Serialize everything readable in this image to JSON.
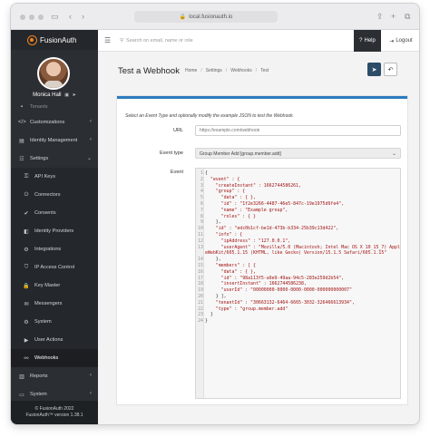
{
  "browser": {
    "url": "local.fusionauth.io"
  },
  "brand": {
    "name": "FusionAuth"
  },
  "user": {
    "name": "Monica Hall"
  },
  "sidebar": {
    "cut_item": "Tenants",
    "items": [
      {
        "label": "Customizations",
        "icon": "code-icon",
        "chevron": "‹",
        "type": "top"
      },
      {
        "label": "Identity Management",
        "icon": "id-card-icon",
        "chevron": "‹",
        "type": "top"
      },
      {
        "label": "Settings",
        "icon": "sliders-icon",
        "chevron": "⌄",
        "type": "top"
      },
      {
        "label": "API Keys",
        "icon": "key-icon",
        "type": "sub"
      },
      {
        "label": "Connectors",
        "icon": "plug-icon",
        "type": "sub"
      },
      {
        "label": "Consents",
        "icon": "check-icon",
        "type": "sub"
      },
      {
        "label": "Identity Providers",
        "icon": "id-icon",
        "type": "sub"
      },
      {
        "label": "Integrations",
        "icon": "gear-icon",
        "type": "sub"
      },
      {
        "label": "IP Access Control",
        "icon": "shield-icon",
        "type": "sub"
      },
      {
        "label": "Key Master",
        "icon": "lock-icon",
        "type": "sub"
      },
      {
        "label": "Messengers",
        "icon": "chat-icon",
        "type": "sub"
      },
      {
        "label": "System",
        "icon": "cog-icon",
        "type": "sub"
      },
      {
        "label": "User Actions",
        "icon": "play-icon",
        "type": "sub"
      },
      {
        "label": "Webhooks",
        "icon": "link-icon",
        "type": "sub",
        "active": true
      },
      {
        "label": "Reports",
        "icon": "chart-icon",
        "chevron": "‹",
        "type": "top"
      },
      {
        "label": "System",
        "icon": "desktop-icon",
        "chevron": "‹",
        "type": "top"
      }
    ],
    "footer_line1": "© FusionAuth 2022",
    "footer_line2": "FusionAuth™ version 1.38.1"
  },
  "topbar": {
    "search_placeholder": "Search on email, name or role",
    "help_label": "Help",
    "logout_label": "Logout"
  },
  "page": {
    "title": "Test a Webhook",
    "breadcrumbs": [
      "Home",
      "Settings",
      "Webhooks",
      "Test"
    ]
  },
  "form": {
    "intro": "Select an Event Type and optionally modify the example JSON to test the Webhook.",
    "url_label": "URL",
    "url_placeholder": "https://example.com/webhook",
    "event_type_label": "Event type",
    "event_type_value": "Group Member Add [group.member.add]",
    "event_label": "Event",
    "event_json": [
      "{",
      "  \"event\" : {",
      "    \"createInstant\" : 1662744586261,",
      "    \"group\" : {",
      "      \"data\" : { },",
      "      \"id\" : \"1f2e3266-4487-46e5-847c-19e1975d6fe4\",",
      "      \"name\" : \"Example group\",",
      "      \"roles\" : { }",
      "    },",
      "    \"id\" : \"edc0b1cf-be1d-473b-b334-25b39c13d422\",",
      "    \"info\" : {",
      "      \"ipAddress\" : \"127.0.0.1\",",
      "      \"userAgent\" : \"Mozilla/5.0 (Macintosh; Intel Mac OS X 10_15_7) AppleWebKit/605.1.15 (KHTML, like Gecko) Version/15.1.5 Safari/605.1.15\"",
      "    },",
      "    \"members\" : [ {",
      "      \"data\" : { },",
      "      \"id\" : \"98a113f5-a9e9-49aa-94c5-283e259d2b54\",",
      "      \"insertInstant\" : 1662744586238,",
      "      \"userId\" : \"00000000-0000-0000-0000-000000000007\"",
      "    } ],",
      "    \"tenantId\" : \"30663132-6464-6665-3032-326466613934\",",
      "    \"type\" : \"group.member.add\"",
      "  }",
      "}"
    ]
  }
}
